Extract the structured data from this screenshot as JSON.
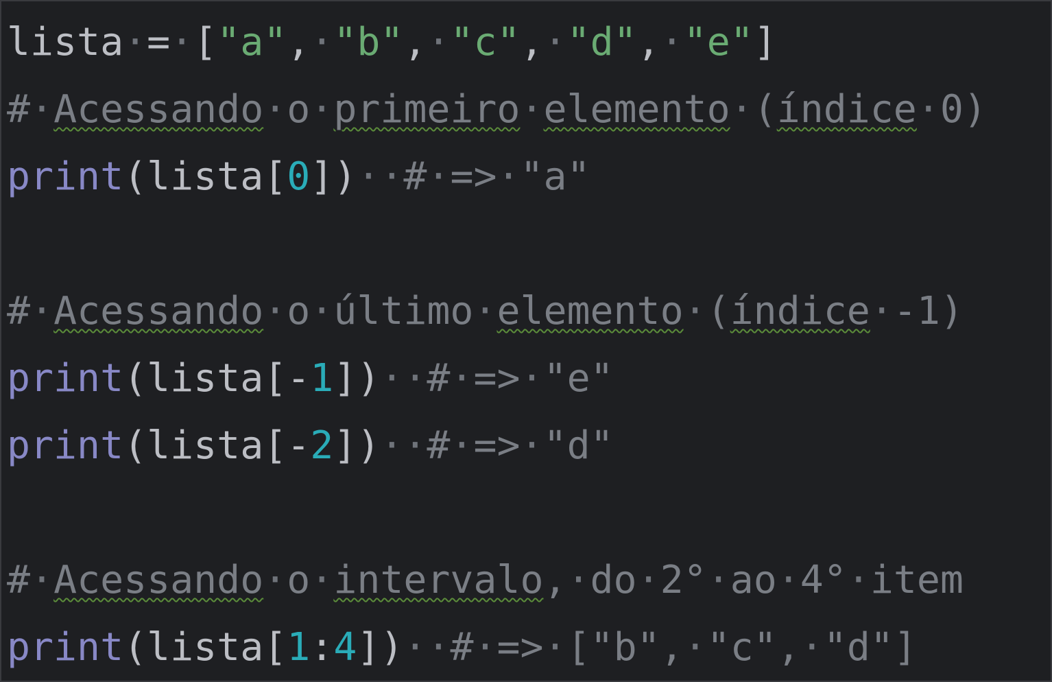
{
  "editor": {
    "language": "python",
    "colors": {
      "background": "#1e1f22",
      "default_text": "#bcbec4",
      "builtin": "#8888c6",
      "string": "#6aab73",
      "number": "#2aacb8",
      "comment": "#7a7e85",
      "whitespace_dot": "#6f737a",
      "spellcheck_underline": "#5b8c3a"
    },
    "lines": [
      "lista = [\"a\", \"b\", \"c\", \"d\", \"e\"]",
      "# Acessando o primeiro elemento (índice 0)",
      "print(lista[0])  # => \"a\"",
      "",
      "# Acessando o último elemento (índice -1)",
      "print(lista[-1])  # => \"e\"",
      "print(lista[-2])  # => \"d\"",
      "",
      "# Acessando o intervalo, do 2° ao 4° item",
      "print(lista[1:4])  # => [\"b\", \"c\", \"d\"]"
    ]
  }
}
